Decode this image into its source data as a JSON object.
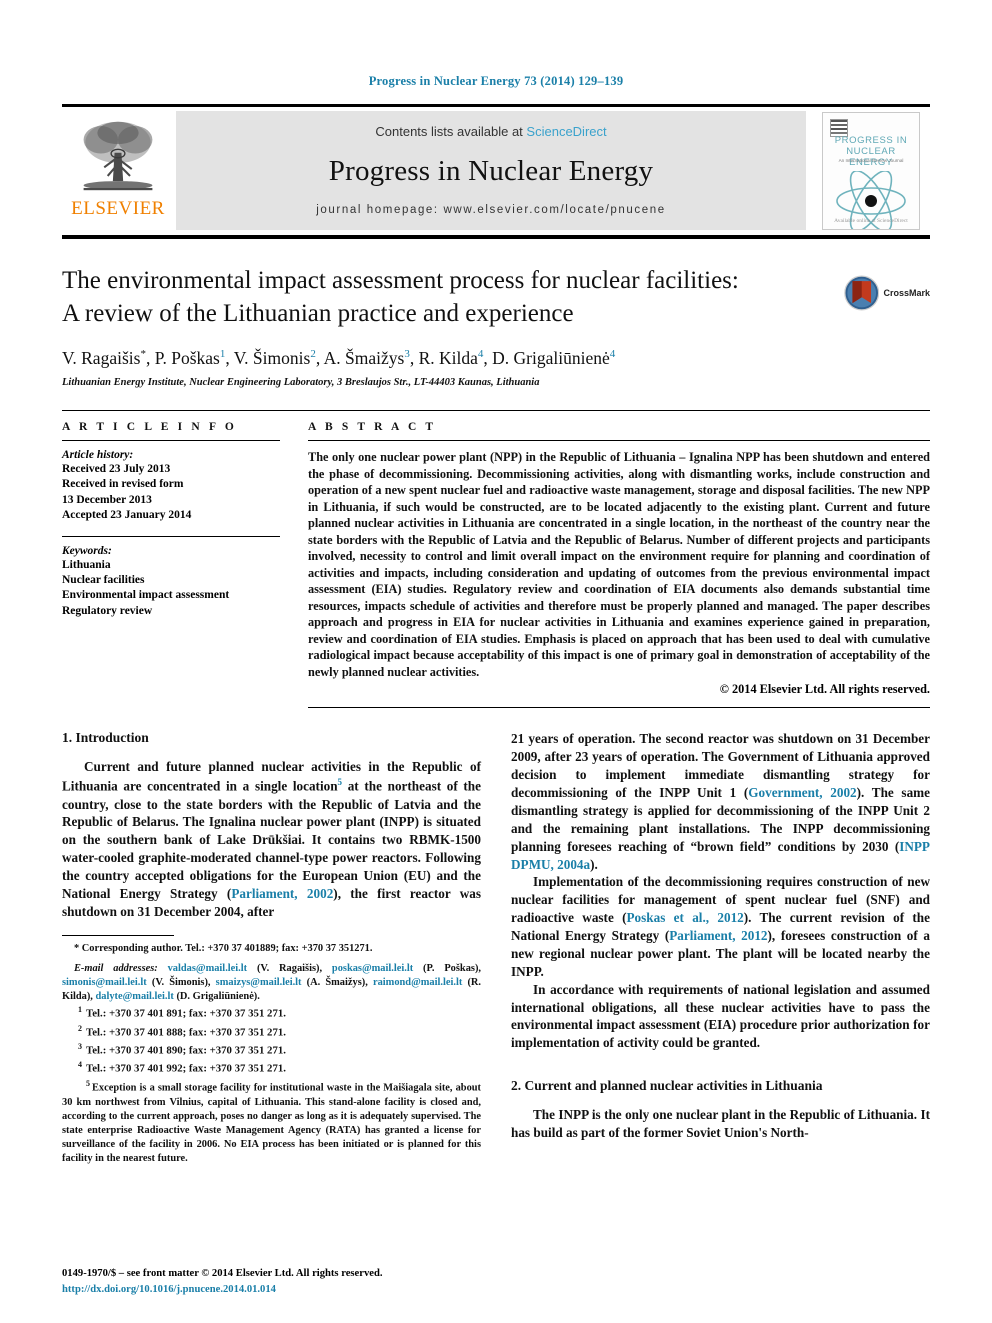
{
  "running_head": "Progress in Nuclear Energy 73 (2014) 129–139",
  "masthead": {
    "publisher_name": "ELSEVIER",
    "contents_prefix": "Contents lists available at",
    "contents_link": "ScienceDirect",
    "journal_title": "Progress in Nuclear Energy",
    "homepage_line": "journal homepage: www.elsevier.com/locate/pnucene",
    "cover": {
      "line1": "PROGRESS IN",
      "line2": "NUCLEAR ENERGY",
      "line3": "An International Review Journal",
      "footer": "Available online at ScienceDirect"
    }
  },
  "article": {
    "title_line1": "The environmental impact assessment process for nuclear facilities:",
    "title_line2": "A review of the Lithuanian practice and experience",
    "authors": [
      {
        "name": "V. Ragaišis",
        "sup": "*"
      },
      {
        "name": "P. Poškas",
        "sup": "1"
      },
      {
        "name": "V. Šimonis",
        "sup": "2"
      },
      {
        "name": "A. Šmaižys",
        "sup": "3"
      },
      {
        "name": "R. Kilda",
        "sup": "4"
      },
      {
        "name": "D. Grigaliūnienė",
        "sup": "4"
      }
    ],
    "affiliation": "Lithuanian Energy Institute, Nuclear Engineering Laboratory, 3 Breslaujos Str., LT-44403 Kaunas, Lithuania",
    "crossmark_label": "CrossMark"
  },
  "article_info": {
    "heading": "A R T I C L E  I N F O",
    "history_label": "Article history:",
    "history": [
      "Received 23 July 2013",
      "Received in revised form",
      "13 December 2013",
      "Accepted 23 January 2014"
    ],
    "keywords_label": "Keywords:",
    "keywords": [
      "Lithuania",
      "Nuclear facilities",
      "Environmental impact assessment",
      "Regulatory review"
    ]
  },
  "abstract": {
    "heading": "A B S T R A C T",
    "text": "The only one nuclear power plant (NPP) in the Republic of Lithuania – Ignalina NPP has been shutdown and entered the phase of decommissioning. Decommissioning activities, along with dismantling works, include construction and operation of a new spent nuclear fuel and radioactive waste management, storage and disposal facilities. The new NPP in Lithuania, if such would be constructed, are to be located adjacently to the existing plant. Current and future planned nuclear activities in Lithuania are concentrated in a single location, in the northeast of the country near the state borders with the Republic of Latvia and the Republic of Belarus. Number of different projects and participants involved, necessity to control and limit overall impact on the environment require for planning and coordination of activities and impacts, including consideration and updating of outcomes from the previous environmental impact assessment (EIA) studies. Regulatory review and coordination of EIA documents also demands substantial time resources, impacts schedule of activities and therefore must be properly planned and managed. The paper describes approach and progress in EIA for nuclear activities in Lithuania and examines experience gained in preparation, review and coordination of EIA studies. Emphasis is placed on approach that has been used to deal with cumulative radiological impact because acceptability of this impact is one of primary goal in demonstration of acceptability of the newly planned nuclear activities.",
    "copyright": "© 2014 Elsevier Ltd. All rights reserved."
  },
  "sections": {
    "intro_heading": "1. Introduction",
    "intro_p1_a": "Current and future planned nuclear activities in the Republic of Lithuania are concentrated in a single location",
    "intro_p1_sup": "5",
    "intro_p1_b": " at the northeast of the country, close to the state borders with the Republic of Latvia and the Republic of Belarus. The Ignalina nuclear power plant (INPP) is situated on the southern bank of Lake Drūkšiai. It contains two RBMK-1500 water-cooled graphite-moderated channel-type power reactors. Following the country accepted obligations for the European Union (EU) and the National Energy Strategy (",
    "intro_p1_cite": "Parliament, 2002",
    "intro_p1_c": "), the first reactor was shutdown on 31 December 2004, after",
    "right_p1_a": "21 years of operation. The second reactor was shutdown on 31 December 2009, after 23 years of operation. The Government of Lithuania approved decision to implement immediate dismantling strategy for decommissioning of the INPP Unit 1 (",
    "right_p1_cite1": "Government, 2002",
    "right_p1_b": "). The same dismantling strategy is applied for decommissioning of the INPP Unit 2 and the remaining plant installations. The INPP decommissioning planning foresees reaching of “brown field” conditions by 2030 (",
    "right_p1_cite2": "INPP DPMU, 2004a",
    "right_p1_c": ").",
    "right_p2_a": "Implementation of the decommissioning requires construction of new nuclear facilities for management of spent nuclear fuel (SNF) and radioactive waste (",
    "right_p2_cite1": "Poskas et al., 2012",
    "right_p2_b": "). The current revision of the National Energy Strategy (",
    "right_p2_cite2": "Parliament, 2012",
    "right_p2_c": "), foresees construction of a new regional nuclear power plant. The plant will be located nearby the INPP.",
    "right_p3": "In accordance with requirements of national legislation and assumed international obligations, all these nuclear activities have to pass the environmental impact assessment (EIA) procedure prior authorization for implementation of activity could be granted.",
    "sec2_heading": "2. Current and planned nuclear activities in Lithuania",
    "sec2_p1": "The INPP is the only one nuclear plant in the Republic of Lithuania. It has build as part of the former Soviet Union's North-"
  },
  "footnotes": {
    "corresponding": "* Corresponding author. Tel.: +370 37 401889; fax: +370 37 351271.",
    "email_label": "E-mail addresses:",
    "emails": [
      {
        "addr": "valdas@mail.lei.lt",
        "who": "(V. Ragaišis),"
      },
      {
        "addr": "poskas@mail.lei.lt",
        "who": "(P. Poškas),"
      },
      {
        "addr": "simonis@mail.lei.lt",
        "who": "(V. Šimonis),"
      },
      {
        "addr": "smaizys@mail.lei.lt",
        "who": "(A. Šmaižys),"
      },
      {
        "addr": "raimond@mail.lei.lt",
        "who": "(R. Kilda),"
      },
      {
        "addr": "dalyte@mail.lei.lt",
        "who": "(D. Grigaliūnienė)."
      }
    ],
    "numbered": [
      {
        "num": "1",
        "text": "Tel.: +370 37 401 891; fax: +370 37 351 271."
      },
      {
        "num": "2",
        "text": "Tel.: +370 37 401 888; fax: +370 37 351 271."
      },
      {
        "num": "3",
        "text": "Tel.: +370 37 401 890; fax: +370 37 351 271."
      },
      {
        "num": "4",
        "text": "Tel.: +370 37 401 992; fax: +370 37 351 271."
      }
    ],
    "note5_num": "5",
    "note5": "Exception is a small storage facility for institutional waste in the Maišiagala site, about 30 km northwest from Vilnius, capital of Lithuania. This stand-alone facility is closed and, according to the current approach, poses no danger as long as it is adequately supervised. The state enterprise Radioactive Waste Management Agency (RATA) has granted a license for surveillance of the facility in 2006. No EIA process has been initiated or is planned for this facility in the nearest future."
  },
  "page_footer": {
    "line1": "0149-1970/$ – see front matter © 2014 Elsevier Ltd. All rights reserved.",
    "doi": "http://dx.doi.org/10.1016/j.pnucene.2014.01.014"
  },
  "colors": {
    "link": "#1a7fa8",
    "elsevier_orange": "#f08000",
    "cover_teal": "#5fa8b5",
    "band_gray": "#e3e3e3"
  }
}
